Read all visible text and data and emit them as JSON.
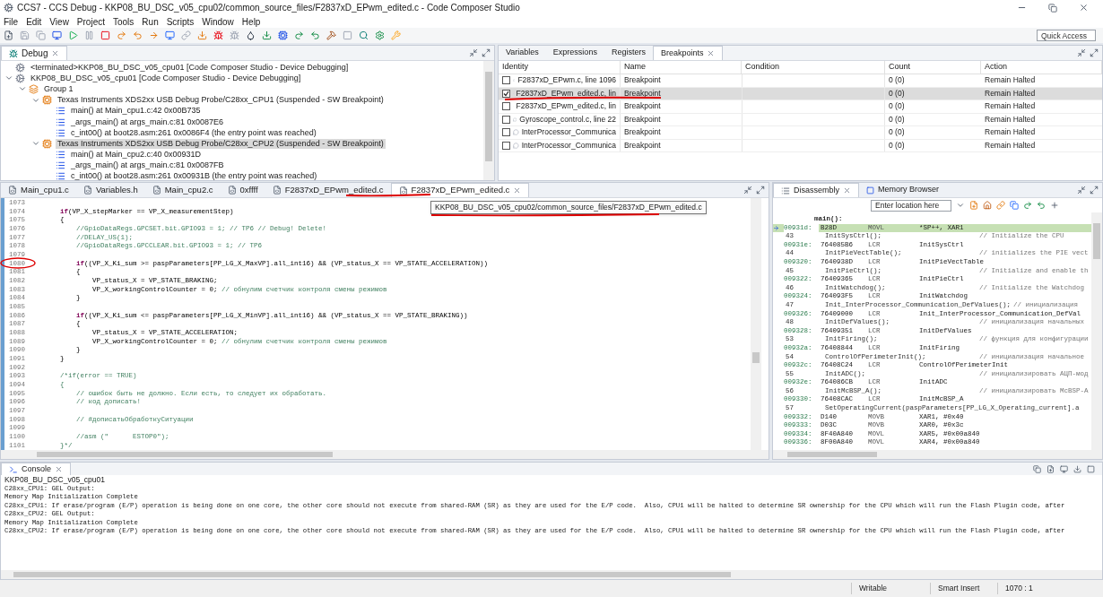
{
  "window": {
    "title": "CCS7 - CCS Debug - KKP08_BU_DSC_v05_cpu02/common_source_files/F2837xD_EPwm_edited.c - Code Composer Studio"
  },
  "menu": [
    "File",
    "Edit",
    "View",
    "Project",
    "Tools",
    "Run",
    "Scripts",
    "Window",
    "Help"
  ],
  "toolbar": {
    "quick_access": {
      "placeholder": "Quick Access"
    }
  },
  "debug_view": {
    "title": "Debug",
    "tree": [
      {
        "kind": "session",
        "label": "<terminated>KKP08_BU_DSC_v05_cpu01 [Code Composer Studio - Device Debugging]",
        "selected": false
      },
      {
        "kind": "session",
        "label": "KKP08_BU_DSC_v05_cpu01 [Code Composer Studio - Device Debugging]",
        "selected": false,
        "expanded": true,
        "children": [
          {
            "kind": "group",
            "label": "Group 1",
            "selected": false,
            "expanded": true,
            "children": [
              {
                "kind": "thread",
                "label": "Texas Instruments XDS2xx USB Debug Probe/C28xx_CPU1 (Suspended - SW Breakpoint)",
                "selected": false,
                "expanded": true,
                "children": [
                  {
                    "kind": "frame",
                    "label": "main() at Main_cpu1.c:42 0x00B735",
                    "selected": false
                  },
                  {
                    "kind": "frame",
                    "label": "_args_main() at args_main.c:81 0x0087E6",
                    "selected": false
                  },
                  {
                    "kind": "frame",
                    "label": "c_int00() at boot28.asm:261 0x0086F4  (the entry point was reached)",
                    "selected": false
                  }
                ]
              },
              {
                "kind": "thread",
                "label": "Texas Instruments XDS2xx USB Debug Probe/C28xx_CPU2 (Suspended - SW Breakpoint)",
                "selected": true,
                "expanded": true,
                "children": [
                  {
                    "kind": "frame",
                    "label": "main() at Main_cpu2.c:40 0x00931D",
                    "selected": false
                  },
                  {
                    "kind": "frame",
                    "label": "_args_main() at args_main.c:81 0x0087FB",
                    "selected": false
                  },
                  {
                    "kind": "frame",
                    "label": "c_int00() at boot28.asm:261 0x00931B  (the entry point was reached)",
                    "selected": false
                  }
                ]
              }
            ]
          }
        ]
      }
    ]
  },
  "breakpoints_view": {
    "tabs": [
      {
        "label": "Variables",
        "selected": false
      },
      {
        "label": "Expressions",
        "selected": false
      },
      {
        "label": "Registers",
        "selected": false
      },
      {
        "label": "Breakpoints",
        "selected": true
      }
    ],
    "columns": [
      "Identity",
      "Name",
      "Condition",
      "Count",
      "Action"
    ],
    "rows": [
      {
        "checked": false,
        "selected": false,
        "identity": "F2837xD_EPwm.c, line 1096",
        "name": "Breakpoint",
        "count": "0 (0)",
        "action": "Remain Halted"
      },
      {
        "checked": true,
        "selected": true,
        "identity": "F2837xD_EPwm_edited.c, lin",
        "name": "Breakpoint",
        "count": "0 (0)",
        "action": "Remain Halted"
      },
      {
        "checked": false,
        "selected": false,
        "identity": "F2837xD_EPwm_edited.c, lin",
        "name": "Breakpoint",
        "count": "0 (0)",
        "action": "Remain Halted"
      },
      {
        "checked": false,
        "selected": false,
        "identity": "Gyroscope_control.c, line 22",
        "name": "Breakpoint",
        "count": "0 (0)",
        "action": "Remain Halted"
      },
      {
        "checked": false,
        "selected": false,
        "identity": "InterProcessor_Communica",
        "name": "Breakpoint",
        "count": "0 (0)",
        "action": "Remain Halted"
      },
      {
        "checked": false,
        "selected": false,
        "identity": "InterProcessor_Communica",
        "name": "Breakpoint",
        "count": "0 (0)",
        "action": "Remain Halted"
      }
    ]
  },
  "editor": {
    "tabs": [
      {
        "label": "Main_cpu1.c",
        "selected": false
      },
      {
        "label": "Variables.h",
        "selected": false
      },
      {
        "label": "Main_cpu2.c",
        "selected": false
      },
      {
        "label": "0xffff",
        "selected": false
      },
      {
        "label": "F2837xD_EPwm_edited.c",
        "selected": false
      },
      {
        "label": "F2837xD_EPwm_edited.c",
        "selected": true
      }
    ],
    "tooltip": "KKP08_BU_DSC_v05_cpu02/common_source_files/F2837xD_EPwm_edited.c",
    "lines": [
      {
        "num": "1073"
      },
      {
        "num": "1074",
        "parts": [
          {
            "kind": "keyword",
            "text": "    if"
          },
          {
            "kind": "code",
            "text": "(VP_X_stepMarker == VP_X_measurementStep)"
          }
        ]
      },
      {
        "num": "1075",
        "parts": [
          {
            "kind": "code",
            "text": "    {"
          }
        ]
      },
      {
        "num": "1076",
        "parts": [
          {
            "kind": "comment",
            "text": "        //GpioDataRegs.GPCSET.bit.GPIO93 = 1; // TP6 // Debug! Delete!"
          }
        ]
      },
      {
        "num": "1077",
        "parts": [
          {
            "kind": "comment",
            "text": "        //DELAY_US(1);"
          }
        ]
      },
      {
        "num": "1078",
        "parts": [
          {
            "kind": "comment",
            "text": "        //GpioDataRegs.GPCCLEAR.bit.GPIO93 = 1; // TP6"
          }
        ]
      },
      {
        "num": "1079"
      },
      {
        "num": "1080",
        "parts": [
          {
            "kind": "keyword",
            "text": "        if"
          },
          {
            "kind": "code",
            "text": "((VP_X_Ki_sum >= paspParameters[PP_LG_X_MaxVP].all_int16) && (VP_status_X == VP_STATE_ACCELERATION))"
          }
        ]
      },
      {
        "num": "1081",
        "parts": [
          {
            "kind": "code",
            "text": "        {"
          }
        ]
      },
      {
        "num": "1082",
        "parts": [
          {
            "kind": "code",
            "text": "            VP_status_X = VP_STATE_BRAKING;"
          }
        ]
      },
      {
        "num": "1083",
        "parts": [
          {
            "kind": "code",
            "text": "            VP_X_workingControlCounter = 0; "
          },
          {
            "kind": "comment",
            "text": "// обнулим счетчик контроля смены режимов"
          }
        ]
      },
      {
        "num": "1084",
        "parts": [
          {
            "kind": "code",
            "text": "        }"
          }
        ]
      },
      {
        "num": "1085"
      },
      {
        "num": "1086",
        "parts": [
          {
            "kind": "keyword",
            "text": "        if"
          },
          {
            "kind": "code",
            "text": "((VP_X_Ki_sum <= paspParameters[PP_LG_X_MinVP].all_int16) && (VP_status_X == VP_STATE_BRAKING))"
          }
        ]
      },
      {
        "num": "1087",
        "parts": [
          {
            "kind": "code",
            "text": "        {"
          }
        ]
      },
      {
        "num": "1088",
        "parts": [
          {
            "kind": "code",
            "text": "            VP_status_X = VP_STATE_ACCELERATION;"
          }
        ]
      },
      {
        "num": "1089",
        "parts": [
          {
            "kind": "code",
            "text": "            VP_X_workingControlCounter = 0; "
          },
          {
            "kind": "comment",
            "text": "// обнулим счетчик контроля смены режимов"
          }
        ]
      },
      {
        "num": "1090",
        "parts": [
          {
            "kind": "code",
            "text": "        }"
          }
        ]
      },
      {
        "num": "1091",
        "parts": [
          {
            "kind": "code",
            "text": "    }"
          }
        ]
      },
      {
        "num": "1092"
      },
      {
        "num": "1093",
        "parts": [
          {
            "kind": "comment",
            "text": "    /*if(error == TRUE)"
          }
        ]
      },
      {
        "num": "1094",
        "parts": [
          {
            "kind": "comment",
            "text": "    {"
          }
        ]
      },
      {
        "num": "1095",
        "parts": [
          {
            "kind": "comment",
            "text": "        // ошибок быть не должно. Если есть, то следует их обработать."
          }
        ]
      },
      {
        "num": "1096",
        "parts": [
          {
            "kind": "comment",
            "text": "        // код дописать!"
          }
        ]
      },
      {
        "num": "1097"
      },
      {
        "num": "1098",
        "parts": [
          {
            "kind": "comment",
            "text": "        // #дописатьОбработкуСитуации"
          }
        ]
      },
      {
        "num": "1099"
      },
      {
        "num": "1100",
        "parts": [
          {
            "kind": "comment",
            "text": "        //asm (\"      ESTOP0\");"
          }
        ]
      },
      {
        "num": "1101",
        "parts": [
          {
            "kind": "comment",
            "text": "    }*/"
          }
        ]
      }
    ]
  },
  "disassembly": {
    "tabs": [
      {
        "label": "Disassembly",
        "selected": true
      },
      {
        "label": "Memory Browser",
        "selected": false
      }
    ],
    "location_field": {
      "placeholder": "Enter location here"
    },
    "function_label": "main():",
    "rows": [
      {
        "kind": "asm",
        "address": "00931d:",
        "opcode": "B28D",
        "mnemonic": "MOVL",
        "operand": "*SP++, XAR1",
        "current": true
      },
      {
        "kind": "source",
        "line": "43",
        "source": "InitSysCtrl();",
        "comment": "// Initialize the CPU"
      },
      {
        "kind": "asm",
        "address": "00931e:",
        "opcode": "764085B6",
        "mnemonic": "LCR",
        "operand": "InitSysCtrl",
        "current": false
      },
      {
        "kind": "source",
        "line": "44",
        "source": "InitPieVectTable();",
        "comment": "// initializes the PIE vect"
      },
      {
        "kind": "asm",
        "address": "009320:",
        "opcode": "7640938D",
        "mnemonic": "LCR",
        "operand": "InitPieVectTable",
        "current": false
      },
      {
        "kind": "source",
        "line": "45",
        "source": "InitPieCtrl();",
        "comment": "// Initialize and enable th"
      },
      {
        "kind": "asm",
        "address": "009322:",
        "opcode": "76409365",
        "mnemonic": "LCR",
        "operand": "InitPieCtrl",
        "current": false
      },
      {
        "kind": "source",
        "line": "46",
        "source": "InitWatchdog();",
        "comment": "// Initialize the Watchdog"
      },
      {
        "kind": "asm",
        "address": "009324:",
        "opcode": "764093F5",
        "mnemonic": "LCR",
        "operand": "InitWatchdog",
        "current": false
      },
      {
        "kind": "source",
        "line": "47",
        "source": "Init_InterProcessor_Communication_DefValues();",
        "comment": "// инициализация"
      },
      {
        "kind": "asm",
        "address": "009326:",
        "opcode": "76409000",
        "mnemonic": "LCR",
        "operand": "Init_InterProcessor_Communication_DefVal",
        "current": false
      },
      {
        "kind": "source",
        "line": "48",
        "source": "InitDefValues();",
        "comment": "// инициализация начальных"
      },
      {
        "kind": "asm",
        "address": "009328:",
        "opcode": "76409351",
        "mnemonic": "LCR",
        "operand": "InitDefValues",
        "current": false
      },
      {
        "kind": "source",
        "line": "53",
        "source": "InitFiring();",
        "comment": "// функция для конфигурации"
      },
      {
        "kind": "asm",
        "address": "00932a:",
        "opcode": "76408844",
        "mnemonic": "LCR",
        "operand": "InitFiring",
        "current": false
      },
      {
        "kind": "source",
        "line": "54",
        "source": "ControlOfPerimeterInit();",
        "comment": "// инициализация начальное"
      },
      {
        "kind": "asm",
        "address": "00932c:",
        "opcode": "76408C24",
        "mnemonic": "LCR",
        "operand": "ControlOfPerimeterInit",
        "current": false
      },
      {
        "kind": "source",
        "line": "55",
        "source": "InitADC();",
        "comment": "// инициализировать АЦП-мод"
      },
      {
        "kind": "asm",
        "address": "00932e:",
        "opcode": "764086CB",
        "mnemonic": "LCR",
        "operand": "InitADC",
        "current": false
      },
      {
        "kind": "source",
        "line": "56",
        "source": "InitMcBSP_A();",
        "comment": "// инициализировать McBSP-A"
      },
      {
        "kind": "asm",
        "address": "009330:",
        "opcode": "76408CAC",
        "mnemonic": "LCR",
        "operand": "InitMcBSP_A",
        "current": false
      },
      {
        "kind": "source",
        "line": "57",
        "source": "SetOperatingCurrent(paspParameters[PP_LG_X_Operating_current].a"
      },
      {
        "kind": "asm",
        "address": "009332:",
        "opcode": "D140",
        "mnemonic": "MOVB",
        "operand": "XAR1, #0x40",
        "current": false
      },
      {
        "kind": "asm",
        "address": "009333:",
        "opcode": "D03C",
        "mnemonic": "MOVB",
        "operand": "XAR0, #0x3c",
        "current": false
      },
      {
        "kind": "asm",
        "address": "009334:",
        "opcode": "8F40A840",
        "mnemonic": "MOVL",
        "operand": "XAR5, #0x00a840",
        "current": false
      },
      {
        "kind": "asm",
        "address": "009336:",
        "opcode": "8F00A840",
        "mnemonic": "MOVL",
        "operand": "XAR4, #0x00a840",
        "current": false
      }
    ]
  },
  "console": {
    "title": "Console",
    "session": "KKP08_BU_DSC_v05_cpu01",
    "lines": [
      "C28xx_CPU1: GEL Output:",
      "Memory Map Initialization Complete",
      "C28xx_CPU1: If erase/program (E/P) operation is being done on one core, the other core should not execute from shared-RAM (SR) as they are used for the E/P code.  Also, CPU1 will be halted to determine SR ownership for the CPU which will run the Flash Plugin code, after",
      "C28xx_CPU2: GEL Output:",
      "Memory Map Initialization Complete",
      "C28xx_CPU2: If erase/program (E/P) operation is being done on one core, the other core should not execute from shared-RAM (SR) as they are used for the E/P code.  Also, CPU1 will be halted to determine SR ownership for the CPU which will run the Flash Plugin code, after"
    ]
  },
  "status_bar": [
    "Writable",
    "Smart Insert",
    "1070 : 1"
  ]
}
